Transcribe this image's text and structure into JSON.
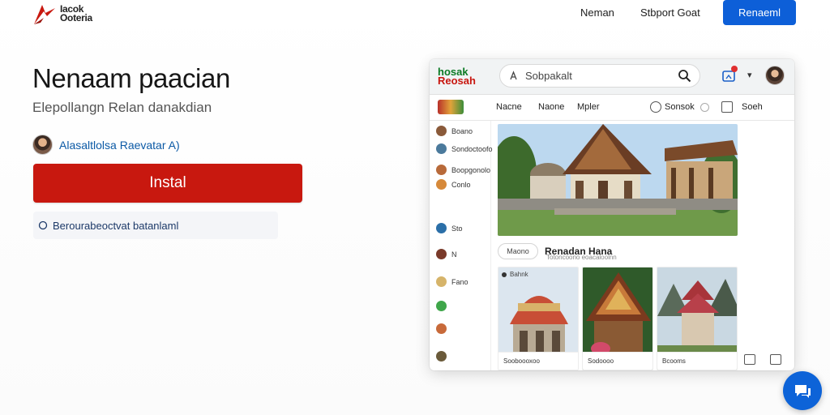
{
  "header": {
    "logo_line1": "Iacok",
    "logo_line2": "Ooteria",
    "nav": [
      "Neman",
      "Stbport Goat"
    ],
    "cta_label": "Renaeml"
  },
  "hero": {
    "title": "Nenaam paacian",
    "subtitle": "Elepollangn Relan danakdian",
    "developer": "Alasaltlolsa Raevatar A)",
    "install_label": "Instal",
    "info_text": "Berourabeoctvat batanlaml"
  },
  "preview": {
    "logo_line1": "hosak",
    "logo_line2": "Reosah",
    "search_placeholder": "Sobpakalt",
    "tabs": [
      "Nacne",
      "Naone",
      "Mpler",
      "Sonsok",
      "Soeh"
    ],
    "sidebar": [
      "Boano",
      "Sondoctoofo",
      "Boopgonolo",
      "Conlo",
      "Sto",
      "N",
      "Fano",
      "",
      "",
      ""
    ],
    "feature_pill": "Maono",
    "feature_title": "Renadan Hana",
    "feature_sub": "Totoncoono eoacaloolnn",
    "card1_head": "Bahnk",
    "card1_foot": "Sooboooxoo",
    "card2_foot": "Sodoooo",
    "card3_foot": "Bcooms"
  },
  "colors": {
    "primary_blue": "#0d5fd8",
    "install_red": "#c8180f",
    "link_blue": "#0c5aa6"
  },
  "icons": [
    "logo-mark",
    "info-icon",
    "search-icon",
    "magnifier-icon",
    "cast-icon",
    "notification-badge",
    "chevron-down-icon",
    "avatar",
    "fab-chat-icon"
  ]
}
